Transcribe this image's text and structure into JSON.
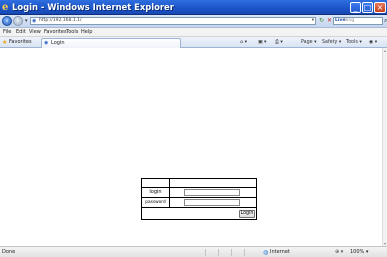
{
  "window": {
    "title": "Login - Windows Internet Explorer",
    "minimize": "_",
    "maximize": "□",
    "close": "×"
  },
  "nav": {
    "back": "‹",
    "forward": "›",
    "dropdown": "▾",
    "address": "http://192.168.1.1/",
    "go": "▾",
    "refresh": "↻",
    "stop": "✕",
    "search_provider": "Live",
    "search_placeholder": "Bing",
    "search_go": "⌕"
  },
  "menu": {
    "items": [
      "File",
      "Edit",
      "View",
      "Favorites",
      "Tools",
      "Help"
    ]
  },
  "favorites_bar": {
    "label": "Favorites",
    "tab_label": "Login",
    "commands": [
      "Page ▾",
      "Safety ▾",
      "Tools ▾"
    ]
  },
  "form": {
    "login_label": "login",
    "password_label": "password",
    "login_value": "",
    "password_value": "",
    "submit_label": "Login"
  },
  "status": {
    "text": "Done",
    "zone": "Internet",
    "zoom": "100% ▾"
  },
  "icons": [
    "ie-logo-icon",
    "back-icon",
    "forward-icon",
    "page-icon",
    "refresh-icon",
    "stop-icon",
    "search-icon",
    "star-icon",
    "globe-icon",
    "zoom-icon"
  ]
}
